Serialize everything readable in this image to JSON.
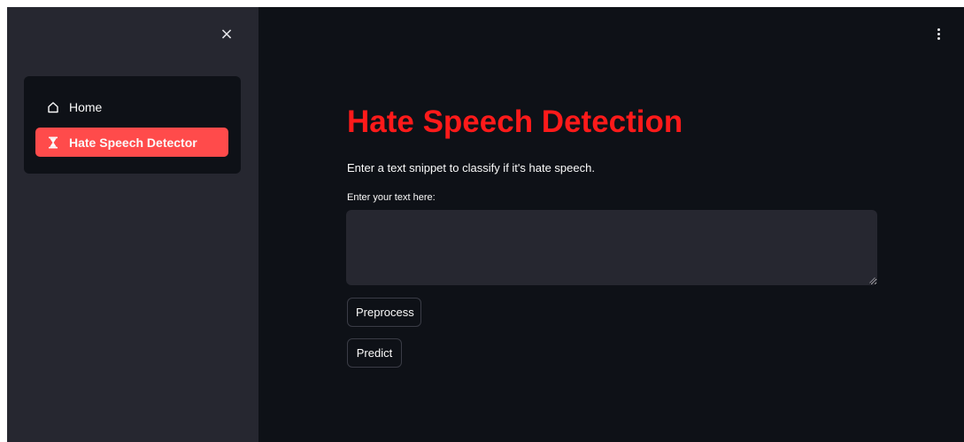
{
  "sidebar": {
    "close_label": "×",
    "nav": {
      "items": [
        {
          "label": "Home",
          "icon": "home-icon",
          "active": false
        },
        {
          "label": "Hate Speech Detector",
          "icon": "hourglass-icon",
          "active": true
        }
      ]
    }
  },
  "main": {
    "title": "Hate Speech Detection",
    "subtitle": "Enter a text snippet to classify if it's hate speech.",
    "input_label": "Enter your text here:",
    "input_value": "",
    "buttons": {
      "preprocess": "Preprocess",
      "predict": "Predict"
    }
  },
  "colors": {
    "background": "#0e1117",
    "sidebar": "#262730",
    "accent": "#ff4b4b",
    "title": "#ff1a1a"
  }
}
